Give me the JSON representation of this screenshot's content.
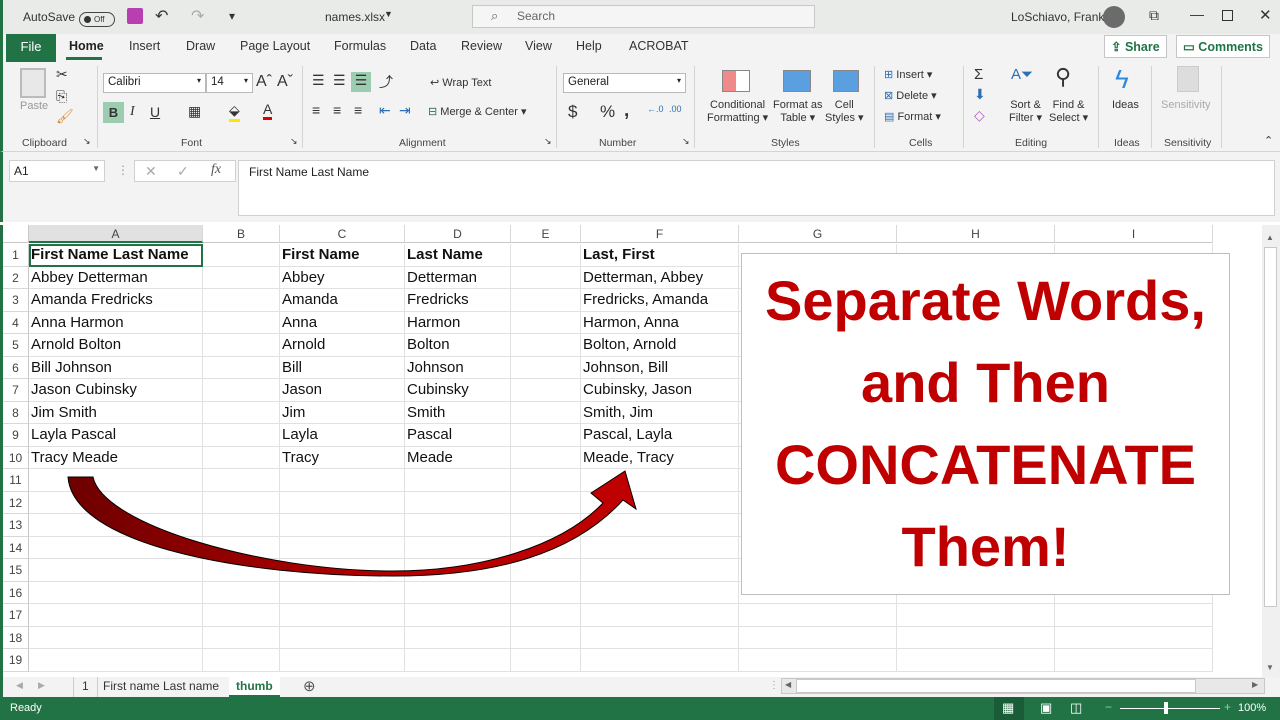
{
  "titlebar": {
    "autosave_label": "AutoSave",
    "autosave_state": "Off",
    "file_name": "names.xlsx",
    "search_placeholder": "Search",
    "user_name": "LoSchiavo, Frank"
  },
  "tabs": [
    "File",
    "Home",
    "Insert",
    "Draw",
    "Page Layout",
    "Formulas",
    "Data",
    "Review",
    "View",
    "Help",
    "ACROBAT"
  ],
  "active_tab": "Home",
  "share_label": "Share",
  "comments_label": "Comments",
  "ribbon": {
    "clipboard": {
      "paste": "Paste",
      "label": "Clipboard"
    },
    "font": {
      "name": "Calibri",
      "size": "14",
      "label": "Font"
    },
    "alignment": {
      "wrap": "Wrap Text",
      "merge": "Merge & Center",
      "label": "Alignment"
    },
    "number": {
      "format": "General",
      "label": "Number"
    },
    "styles": {
      "cond1": "Conditional",
      "cond2": "Formatting",
      "fmt1": "Format as",
      "fmt2": "Table",
      "cell1": "Cell",
      "cell2": "Styles",
      "label": "Styles"
    },
    "cells": {
      "insert": "Insert",
      "delete": "Delete",
      "format": "Format",
      "label": "Cells"
    },
    "editing": {
      "sort1": "Sort &",
      "sort2": "Filter",
      "find1": "Find &",
      "find2": "Select",
      "label": "Editing"
    },
    "ideas": {
      "btn": "Ideas",
      "label": "Ideas"
    },
    "sensitivity": {
      "btn": "Sensitivity",
      "label": "Sensitivity"
    }
  },
  "formula_bar": {
    "name_box": "A1",
    "formula": "First Name Last Name"
  },
  "columns": [
    "A",
    "B",
    "C",
    "D",
    "E",
    "F",
    "G",
    "H",
    "I"
  ],
  "rows": [
    [
      "First Name Last Name",
      "",
      "First Name",
      "Last Name",
      "",
      "Last, First"
    ],
    [
      "Abbey Detterman",
      "",
      "Abbey",
      "Detterman",
      "",
      "Detterman, Abbey"
    ],
    [
      "Amanda Fredricks",
      "",
      "Amanda",
      "Fredricks",
      "",
      "Fredricks, Amanda"
    ],
    [
      "Anna Harmon",
      "",
      "Anna",
      "Harmon",
      "",
      "Harmon, Anna"
    ],
    [
      "Arnold Bolton",
      "",
      "Arnold",
      "Bolton",
      "",
      "Bolton, Arnold"
    ],
    [
      "Bill Johnson",
      "",
      "Bill",
      "Johnson",
      "",
      "Johnson, Bill"
    ],
    [
      "Jason Cubinsky",
      "",
      "Jason",
      "Cubinsky",
      "",
      "Cubinsky, Jason"
    ],
    [
      "Jim Smith",
      "",
      "Jim",
      "Smith",
      "",
      "Smith, Jim"
    ],
    [
      "Layla Pascal",
      "",
      "Layla",
      "Pascal",
      "",
      "Pascal, Layla"
    ],
    [
      "Tracy Meade",
      "",
      "Tracy",
      "Meade",
      "",
      "Meade, Tracy"
    ]
  ],
  "row_numbers": [
    "1",
    "2",
    "3",
    "4",
    "5",
    "6",
    "7",
    "8",
    "9",
    "10",
    "11",
    "12",
    "13",
    "14",
    "15",
    "16",
    "17",
    "18",
    "19"
  ],
  "textbox_lines": [
    "Separate Words,",
    "and Then",
    "CONCATENATE",
    "Them!"
  ],
  "textbox_color": "#c00000",
  "arrow_color": "#a00000",
  "sheet_tabs": [
    "1",
    "First name Last name",
    "thumb"
  ],
  "active_sheet": "thumb",
  "status": {
    "ready": "Ready",
    "zoom": "100%"
  },
  "accent": "#217346"
}
